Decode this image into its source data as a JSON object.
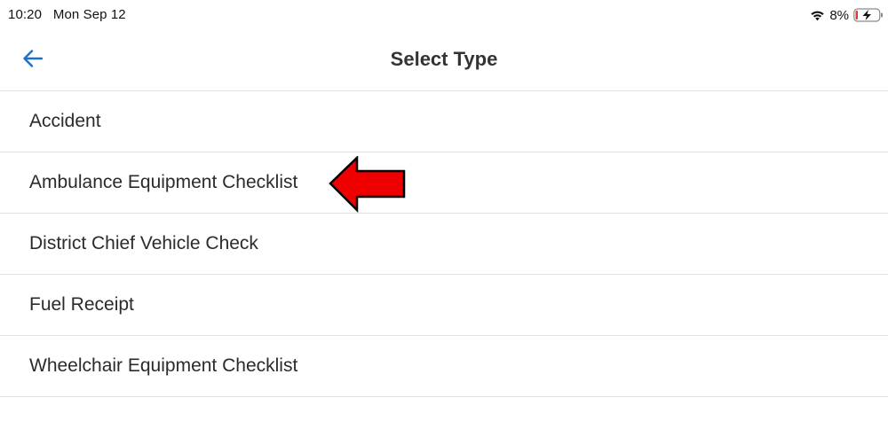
{
  "status_bar": {
    "time": "10:20",
    "date": "Mon Sep 12",
    "battery_percent": "8%",
    "wifi_icon": "wifi-icon",
    "battery_icon": "battery-charging-icon"
  },
  "nav": {
    "title": "Select Type",
    "back_icon": "arrow-left-icon",
    "accent_color": "#1f6fd1"
  },
  "list": {
    "items": [
      {
        "label": "Accident"
      },
      {
        "label": "Ambulance Equipment Checklist"
      },
      {
        "label": "District Chief Vehicle Check"
      },
      {
        "label": "Fuel Receipt"
      },
      {
        "label": "Wheelchair Equipment Checklist"
      }
    ]
  },
  "annotation": {
    "icon": "red-arrow-left-icon",
    "color": "#ee0000",
    "points_to": "Ambulance Equipment Checklist"
  }
}
